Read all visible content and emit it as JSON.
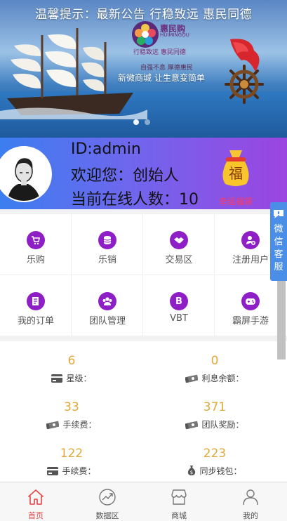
{
  "banner": {
    "notice": "温馨提示：最新公告 行稳致远 惠民同德",
    "brand_name": "惠民购",
    "brand_en": "HUIMINGOU",
    "slogan_small": "行稳致远  惠民同德",
    "slogan_mid": "自强不息  厚德惠民",
    "slogan_main": "新微商城  让生意变简单",
    "dots": 2,
    "active_dot": 0
  },
  "user": {
    "id_line": "ID:admin",
    "welcome_line": "欢迎您：创始人",
    "online_line": "当前在线人数：10",
    "fortune_char": "福",
    "fortune_label": "幸运福袋"
  },
  "grid": [
    {
      "label": "乐购",
      "icon": "shopping-cart-icon",
      "glyph": "🛒"
    },
    {
      "label": "乐销",
      "icon": "database-icon",
      "glyph": "≡"
    },
    {
      "label": "交易区",
      "icon": "handshake-icon",
      "glyph": "✋"
    },
    {
      "label": "注册用户",
      "icon": "add-user-icon",
      "glyph": "+"
    },
    {
      "label": "我的订单",
      "icon": "order-list-icon",
      "glyph": "✎"
    },
    {
      "label": "团队管理",
      "icon": "team-icon",
      "glyph": "♟"
    },
    {
      "label": "VBT",
      "icon": "bitcoin-icon",
      "glyph": "B"
    },
    {
      "label": "霸屏手游",
      "icon": "gamepad-icon",
      "glyph": "✚"
    }
  ],
  "stats": [
    {
      "value": "6",
      "label": "星级：",
      "icon": "card-icon"
    },
    {
      "value": "0",
      "label": "利息余额：",
      "icon": "money-icon"
    },
    {
      "value": "33",
      "label": "手续费：",
      "icon": "money-icon"
    },
    {
      "value": "371",
      "label": "团队奖励：",
      "icon": "money-icon"
    },
    {
      "value": "122",
      "label": "手续费：",
      "icon": "card-icon"
    },
    {
      "value": "223",
      "label": "同步钱包：",
      "icon": "money-bag-icon"
    }
  ],
  "sidefloat": {
    "chars": [
      "微",
      "信",
      "客",
      "服"
    ]
  },
  "tabs": [
    {
      "label": "首页",
      "icon": "home-icon",
      "active": true
    },
    {
      "label": "数据区",
      "icon": "chart-icon",
      "active": false
    },
    {
      "label": "商城",
      "icon": "store-icon",
      "active": false
    },
    {
      "label": "我的",
      "icon": "user-icon",
      "active": false
    }
  ],
  "colors": {
    "accent": "#8e1fc6",
    "stat_value": "#e0a93c",
    "tab_active": "#e54444",
    "sidefloat": "#4b8ee8"
  }
}
